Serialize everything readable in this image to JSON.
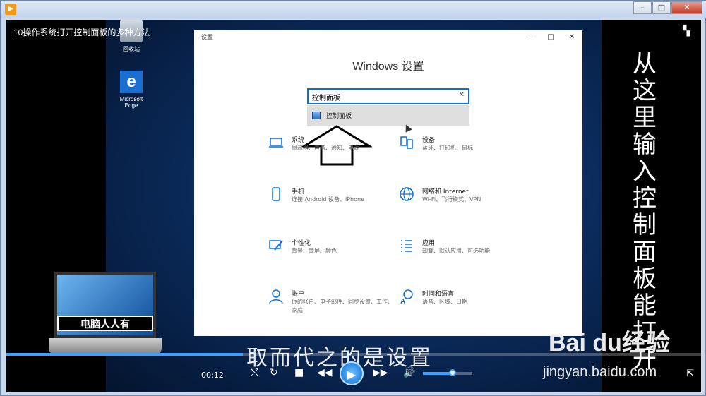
{
  "video_title": "10操作系统打开控制面板的多种方法",
  "desktop": {
    "icons": [
      {
        "label": "回收站"
      },
      {
        "label": "Microsoft Edge"
      }
    ]
  },
  "settings": {
    "caption": "设置",
    "heading": "Windows 设置",
    "search_value": "控制面板",
    "suggestion": "控制面板",
    "categories": [
      {
        "icon": "laptop-icon",
        "title": "系统",
        "desc": "显示器、声音、通知、电源"
      },
      {
        "icon": "devices-icon",
        "title": "设备",
        "desc": "蓝牙、打印机、鼠标"
      },
      {
        "icon": "phone-icon",
        "title": "手机",
        "desc": "连接 Android 设备、iPhone"
      },
      {
        "icon": "globe-icon",
        "title": "网络和 Internet",
        "desc": "Wi-Fi、飞行模式、VPN"
      },
      {
        "icon": "personalization-icon",
        "title": "个性化",
        "desc": "背景、锁屏、颜色"
      },
      {
        "icon": "apps-icon",
        "title": "应用",
        "desc": "卸载、默认应用、可选功能"
      },
      {
        "icon": "account-icon",
        "title": "帐户",
        "desc": "你的帐户、电子邮件、同步设置、工作、家庭"
      },
      {
        "icon": "time-language-icon",
        "title": "时间和语言",
        "desc": "语音、区域、日期"
      }
    ]
  },
  "side_caption": "从这里输入控制面板能打开",
  "subtitle": "取而代之的是设置",
  "laptop_label": "电脑人人有",
  "watermark": {
    "logo": "Bai du经验",
    "url": "jingyan.baidu.com"
  },
  "playback": {
    "time": "00:12",
    "progress": 0.34,
    "volume": 0.6
  },
  "colors": {
    "accent": "#0b6fd8",
    "player_blue": "#3da0ff"
  }
}
